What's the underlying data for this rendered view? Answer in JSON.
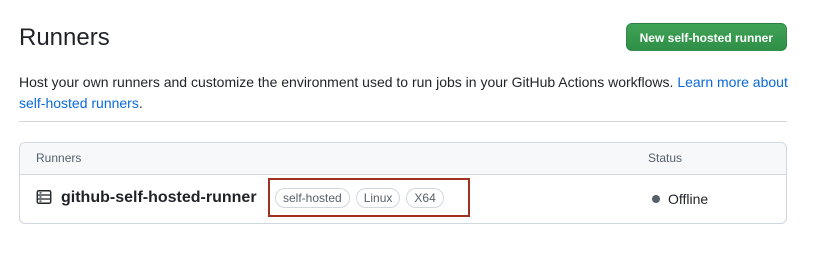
{
  "header": {
    "title": "Runners",
    "new_runner_button": "New self-hosted runner"
  },
  "description": {
    "text": "Host your own runners and customize the environment used to run jobs in your GitHub Actions workflows. ",
    "link_text": "Learn more about self-hosted runners",
    "trailing": "."
  },
  "runners_table": {
    "columns": {
      "runners": "Runners",
      "status": "Status"
    },
    "rows": [
      {
        "name": "github-self-hosted-runner",
        "icon": "server-icon",
        "labels": [
          "self-hosted",
          "Linux",
          "X64"
        ],
        "status": "Offline",
        "status_color": "#57606a"
      }
    ]
  },
  "colors": {
    "primary_button": "#2da44e",
    "link": "#0969da",
    "highlight_border": "#a0301f"
  }
}
